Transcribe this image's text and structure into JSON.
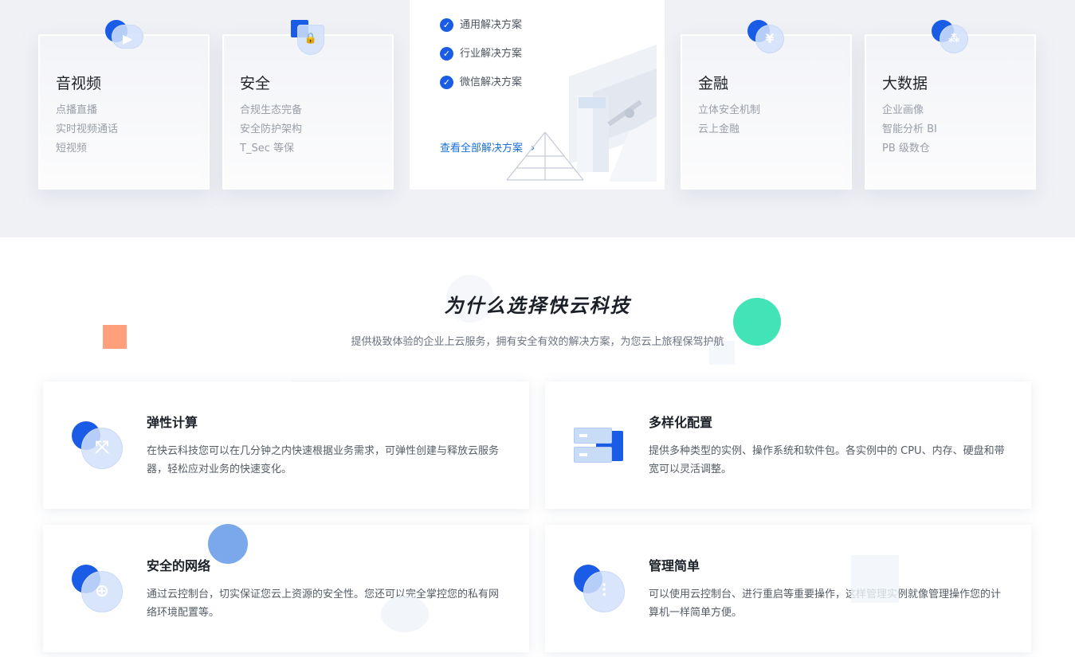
{
  "cards": [
    {
      "title": "音视频",
      "lines": [
        "点播直播",
        "实时视频通话",
        "短视频"
      ],
      "icon": "video-cloud-icon",
      "glyph": "▶"
    },
    {
      "title": "安全",
      "lines": [
        "合规生态完备",
        "安全防护架构",
        "T_Sec 等保"
      ],
      "icon": "lock-shield-icon",
      "glyph": "🔒"
    },
    {
      "title": "金融",
      "lines": [
        "立体安全机制",
        "云上金融"
      ],
      "icon": "yen-icon",
      "glyph": "¥"
    },
    {
      "title": "大数据",
      "lines": [
        "企业画像",
        "智能分析 BI",
        "PB 级数仓"
      ],
      "icon": "network-nodes-icon",
      "glyph": "⁂"
    }
  ],
  "solutions": {
    "items": [
      "通用解决方案",
      "行业解决方案",
      "微信解决方案"
    ],
    "view_all": "查看全部解决方案"
  },
  "why": {
    "title": "为什么选择快云科技",
    "subtitle": "提供极致体验的企业上云服务，拥有安全有效的解决方案，为您云上旅程保驾护航"
  },
  "features": [
    {
      "title": "弹性计算",
      "desc": "在快云科技您可以在几分钟之内快速根据业务需求，可弹性创建与释放云服务器，轻松应对业务的快速变化。",
      "icon": "elastic-arrows-icon",
      "glyph": "⤧"
    },
    {
      "title": "多样化配置",
      "desc": "提供多种类型的实例、操作系统和软件包。各实例中的 CPU、内存、硬盘和带宽可以灵活调整。",
      "icon": "server-stack-icon",
      "glyph": ""
    },
    {
      "title": "安全的网络",
      "desc": "通过云控制台，切实保证您云上资源的安全性。您还可以完全掌控您的私有网络环境配置等。",
      "icon": "globe-icon",
      "glyph": "⊕"
    },
    {
      "title": "管理简单",
      "desc": "可以使用云控制台、进行重启等重要操作，这样管理实例就像管理操作您的计算机一样简单方便。",
      "icon": "sliders-icon",
      "glyph": "⫶"
    }
  ],
  "colors": {
    "accent": "#1a5ce6",
    "link": "#1a6fd9",
    "mint": "#43e3b8",
    "orange": "#ffa07a",
    "purple": "#c99be8"
  }
}
